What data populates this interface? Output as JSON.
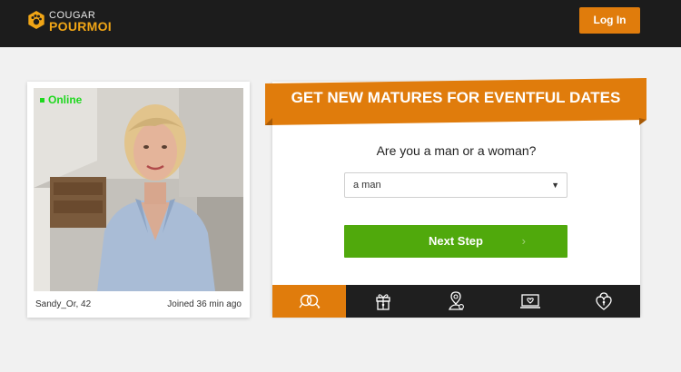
{
  "header": {
    "logo_top": "COUGAR",
    "logo_bottom": "POURMOI",
    "login_label": "Log In"
  },
  "profile": {
    "status": "Online",
    "name": "Sandy_Or, 42",
    "joined": "Joined 36 min ago"
  },
  "form": {
    "banner": "GET NEW MATURES FOR EVENTFUL DATES",
    "question": "Are you a man or a woman?",
    "gender_value": "a man",
    "next_label": "Next Step",
    "next_arrow": "›"
  },
  "tabs": [
    {
      "icon": "couple-icon",
      "active": true
    },
    {
      "icon": "gift-icon",
      "active": false
    },
    {
      "icon": "profile-location-icon",
      "active": false
    },
    {
      "icon": "laptop-heart-icon",
      "active": false
    },
    {
      "icon": "heart-lock-icon",
      "active": false
    }
  ],
  "colors": {
    "accent": "#e07c0c",
    "cta": "#50a90c",
    "online": "#1ed81e",
    "dark": "#1c1c1c"
  }
}
